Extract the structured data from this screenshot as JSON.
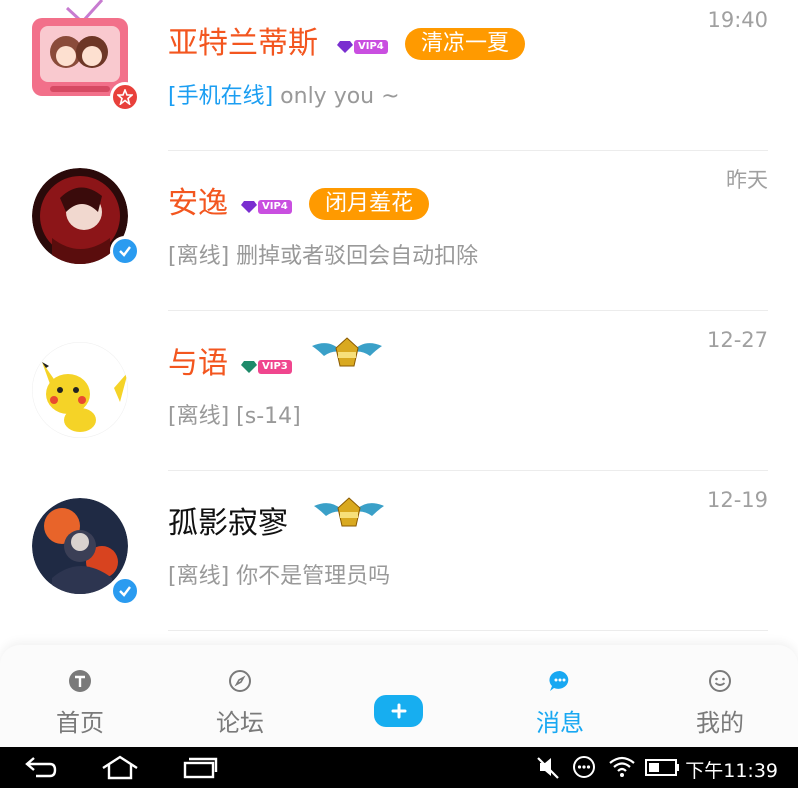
{
  "conversations": [
    {
      "name": "亚特兰蒂斯",
      "name_color": "#f3561f",
      "vip": "VIP4",
      "title_tag": "清凉一夏",
      "status_prefix": "[手机在线]",
      "message": " only you ~",
      "time": "19:40",
      "badge": "star-badge"
    },
    {
      "name": "安逸",
      "name_color": "#f3561f",
      "vip": "VIP4",
      "title_tag": "闭月羞花",
      "status_prefix": "[离线]",
      "message": " 删掉或者驳回会自动扣除",
      "time": "昨天",
      "badge": "verified-badge"
    },
    {
      "name": "与语",
      "name_color": "#f3561f",
      "vip": "VIP3",
      "title_tag": "",
      "status_prefix": "[离线]",
      "message": " [s-14]",
      "time": "12-27",
      "badge": ""
    },
    {
      "name": "孤影寂寥",
      "name_color": "#111111",
      "vip": "",
      "title_tag": "",
      "status_prefix": "[离线]",
      "message": " 你不是管理员吗",
      "time": "12-19",
      "badge": "verified-badge"
    }
  ],
  "tabs": [
    {
      "label": "首页",
      "icon": "home-t-icon",
      "active": false
    },
    {
      "label": "论坛",
      "icon": "compass-icon",
      "active": false
    },
    {
      "label": "",
      "icon": "plus-icon",
      "active": false
    },
    {
      "label": "消息",
      "icon": "chat-bubble-icon",
      "active": true
    },
    {
      "label": "我的",
      "icon": "smiley-icon",
      "active": false
    }
  ],
  "colors": {
    "accent": "#18a8f2",
    "title_tag_bg": "#ff9a00",
    "name_highlight": "#f3561f",
    "vip_purple": "#c94fe0",
    "vip3_pink": "#f0468e"
  },
  "system_bar": {
    "time": "下午11:39",
    "icons": [
      "back-icon",
      "home-icon",
      "recent-apps-icon",
      "mute-icon",
      "more-icon",
      "wifi-icon",
      "battery-icon"
    ]
  }
}
